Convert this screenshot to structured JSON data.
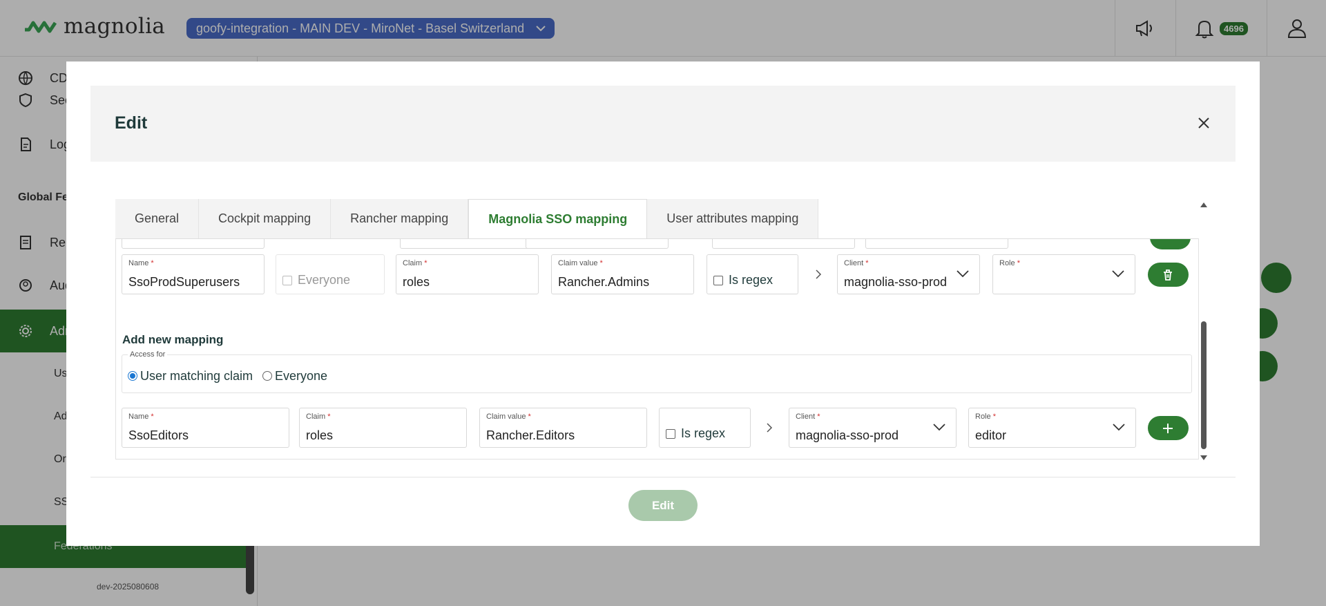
{
  "header": {
    "logo_text": "magnolia",
    "environment": "goofy-integration - MAIN DEV - MiroNet - Basel Switzerland",
    "notification_count": "4696"
  },
  "sidebar": {
    "items": [
      {
        "label": "CDN",
        "icon": "globe-icon"
      },
      {
        "label": "Security",
        "icon": "shield-icon"
      },
      {
        "label": "Logs",
        "icon": "document-icon"
      }
    ],
    "section": "Global Features",
    "items2": [
      {
        "label": "Reports",
        "icon": "report-icon"
      },
      {
        "label": "Audit",
        "icon": "audit-icon"
      },
      {
        "label": "Administration",
        "icon": "gear-icon"
      }
    ],
    "sub_items": [
      "Users",
      "Admins",
      "Organizations",
      "SSO"
    ],
    "active_sub": "Federations",
    "footer": "dev-2025080608"
  },
  "modal": {
    "title": "Edit",
    "tabs": [
      "General",
      "Cockpit mapping",
      "Rancher mapping",
      "Magnolia SSO mapping",
      "User attributes mapping"
    ],
    "active_tab": "Magnolia SSO mapping",
    "existing_row": {
      "name_label": "Name",
      "name_value": "SsoProdSuperusers",
      "everyone_label": "Everyone",
      "claim_label": "Claim",
      "claim_value": "roles",
      "claim_value_label": "Claim value",
      "claim_value_value": "Rancher.Admins",
      "regex_label": "Is regex",
      "client_label": "Client",
      "client_value": "magnolia-sso-prod",
      "role_label": "Role",
      "role_value": ""
    },
    "add_section_title": "Add new mapping",
    "access_for_label": "Access for",
    "access_options": [
      "User matching claim",
      "Everyone"
    ],
    "new_row": {
      "name_label": "Name",
      "name_value": "SsoEditors",
      "claim_label": "Claim",
      "claim_value": "roles",
      "claim_value_label": "Claim value",
      "claim_value_value": "Rancher.Editors",
      "regex_label": "Is regex",
      "client_label": "Client",
      "client_value": "magnolia-sso-prod",
      "role_label": "Role",
      "role_value": "editor"
    },
    "submit_label": "Edit"
  },
  "colors": {
    "brand_green": "#2e7d32",
    "env_blue": "#4a6cc9",
    "disabled_green": "#a9c9ab"
  }
}
